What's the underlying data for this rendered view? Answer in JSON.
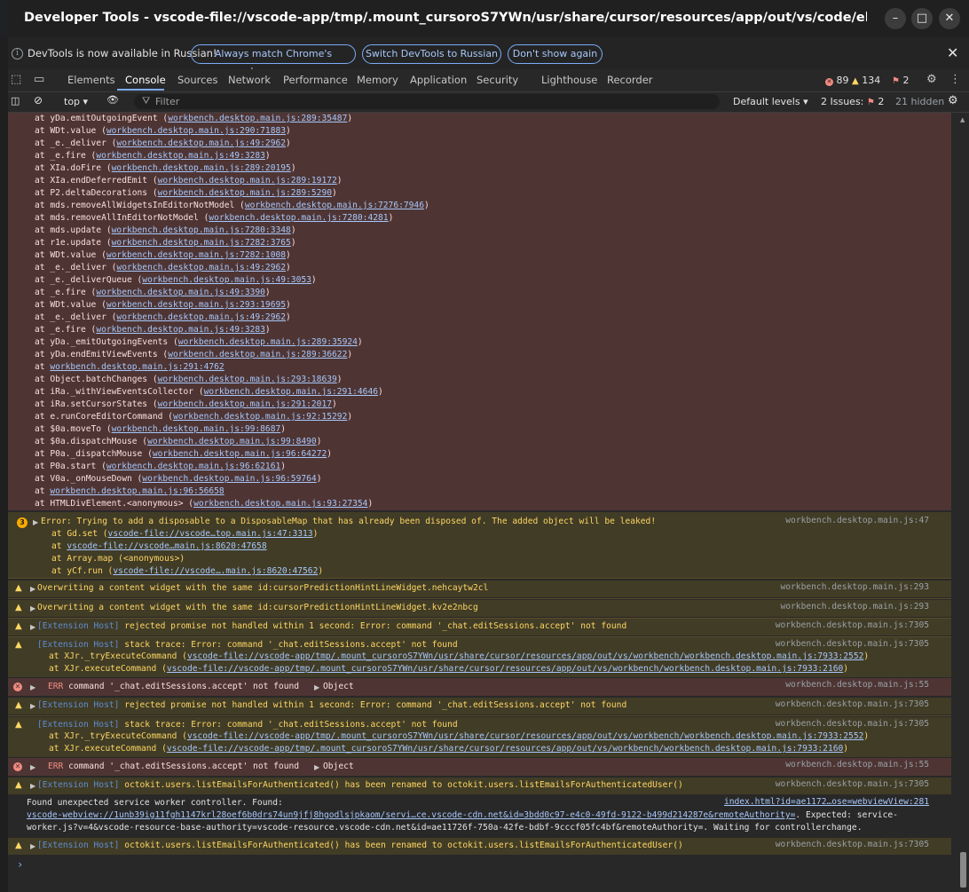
{
  "window": {
    "title": "Developer Tools - vscode-file://vscode-app/tmp/.mount_cursoroS7YWn/usr/share/cursor/resources/app/out/vs/code/electron-sandbo...",
    "min_glyph": "–",
    "max_glyph": "□",
    "close_glyph": "✕"
  },
  "infobar": {
    "message": "DevTools is now available in Russian!",
    "btn_match": "Always match Chrome's language",
    "btn_switch": "Switch DevTools to Russian",
    "btn_dont": "Don't show again",
    "close": "✕"
  },
  "tabs": [
    "Elements",
    "Console",
    "Sources",
    "Network",
    "Performance",
    "Memory",
    "Application",
    "Security",
    "Lighthouse",
    "Recorder"
  ],
  "counts": {
    "errors": "89",
    "warnings": "134",
    "issues": "2"
  },
  "toolbar": {
    "context": "top",
    "filter_placeholder": "Filter",
    "levels": "Default levels",
    "issues_label": "2 Issues:",
    "issues_count": "2",
    "hidden": "21 hidden"
  },
  "stack": [
    {
      "fn": "at yDa.emitOutgoingEvent (",
      "link": "workbench.desktop.main.js:289:35487",
      "end": ")"
    },
    {
      "fn": "at WDt.value (",
      "link": "workbench.desktop.main.js:290:71883",
      "end": ")"
    },
    {
      "fn": "at _e._deliver (",
      "link": "workbench.desktop.main.js:49:2962",
      "end": ")"
    },
    {
      "fn": "at _e.fire (",
      "link": "workbench.desktop.main.js:49:3283",
      "end": ")"
    },
    {
      "fn": "at XIa.doFire (",
      "link": "workbench.desktop.main.js:289:20195",
      "end": ")"
    },
    {
      "fn": "at XIa.endDeferredEmit (",
      "link": "workbench.desktop.main.js:289:19172",
      "end": ")"
    },
    {
      "fn": "at P2.deltaDecorations (",
      "link": "workbench.desktop.main.js:289:5290",
      "end": ")"
    },
    {
      "fn": "at mds.removeAllWidgetsInEditorNotModel (",
      "link": "workbench.desktop.main.js:7276:7946",
      "end": ")"
    },
    {
      "fn": "at mds.removeAllInEditorNotModel (",
      "link": "workbench.desktop.main.js:7280:4281",
      "end": ")"
    },
    {
      "fn": "at mds.update (",
      "link": "workbench.desktop.main.js:7280:3348",
      "end": ")"
    },
    {
      "fn": "at r1e.update (",
      "link": "workbench.desktop.main.js:7282:3765",
      "end": ")"
    },
    {
      "fn": "at WDt.value (",
      "link": "workbench.desktop.main.js:7282:1008",
      "end": ")"
    },
    {
      "fn": "at _e._deliver (",
      "link": "workbench.desktop.main.js:49:2962",
      "end": ")"
    },
    {
      "fn": "at _e._deliverQueue (",
      "link": "workbench.desktop.main.js:49:3053",
      "end": ")"
    },
    {
      "fn": "at _e.fire (",
      "link": "workbench.desktop.main.js:49:3390",
      "end": ")"
    },
    {
      "fn": "at WDt.value (",
      "link": "workbench.desktop.main.js:293:19695",
      "end": ")"
    },
    {
      "fn": "at _e._deliver (",
      "link": "workbench.desktop.main.js:49:2962",
      "end": ")"
    },
    {
      "fn": "at _e.fire (",
      "link": "workbench.desktop.main.js:49:3283",
      "end": ")"
    },
    {
      "fn": "at yDa._emitOutgoingEvents (",
      "link": "workbench.desktop.main.js:289:35924",
      "end": ")"
    },
    {
      "fn": "at yDa.endEmitViewEvents (",
      "link": "workbench.desktop.main.js:289:36622",
      "end": ")"
    },
    {
      "fn": "at ",
      "link": "workbench.desktop.main.js:291:4762",
      "end": ""
    },
    {
      "fn": "at Object.batchChanges (",
      "link": "workbench.desktop.main.js:293:18639",
      "end": ")"
    },
    {
      "fn": "at iRa._withViewEventsCollector (",
      "link": "workbench.desktop.main.js:291:4646",
      "end": ")"
    },
    {
      "fn": "at iRa.setCursorStates (",
      "link": "workbench.desktop.main.js:291:2017",
      "end": ")"
    },
    {
      "fn": "at e.runCoreEditorCommand (",
      "link": "workbench.desktop.main.js:92:15292",
      "end": ")"
    },
    {
      "fn": "at $0a.moveTo (",
      "link": "workbench.desktop.main.js:99:8687",
      "end": ")"
    },
    {
      "fn": "at $0a.dispatchMouse (",
      "link": "workbench.desktop.main.js:99:8490",
      "end": ")"
    },
    {
      "fn": "at P0a._dispatchMouse (",
      "link": "workbench.desktop.main.js:96:64272",
      "end": ")"
    },
    {
      "fn": "at P0a.start (",
      "link": "workbench.desktop.main.js:96:62161",
      "end": ")"
    },
    {
      "fn": "at V0a._onMouseDown (",
      "link": "workbench.desktop.main.js:96:59764",
      "end": ")"
    },
    {
      "fn": "at ",
      "link": "workbench.desktop.main.js:96:56658",
      "end": ""
    },
    {
      "fn": "at HTMLDivElement.<anonymous> (",
      "link": "workbench.desktop.main.js:93:27354",
      "end": ")"
    }
  ],
  "disposable": {
    "count": "3",
    "text": "Error: Trying to add a disposable to a DisposableMap that has already been disposed of. The added object will be leaked!",
    "src": "workbench.desktop.main.js:47",
    "lines": [
      {
        "fn": "at Gd.set (",
        "link": "vscode-file://vscode…top.main.js:47:3313",
        "end": ")"
      },
      {
        "fn": "at ",
        "link": "vscode-file://vscode…main.js:8620:47658",
        "end": ""
      },
      {
        "fn": "at Array.map (<anonymous>)",
        "link": "",
        "end": ""
      },
      {
        "fn": "at yCf.run (",
        "link": "vscode-file://vscode….main.js:8620:47562",
        "end": ")"
      }
    ]
  },
  "msgs": {
    "w1": {
      "text": "Overwriting a content widget with the same id:cursorPredictionHintLineWidget.nehcaytw2cl",
      "src": "workbench.desktop.main.js:293"
    },
    "w2": {
      "text": "Overwriting a content widget with the same id:cursorPredictionHintLineWidget.kv2e2nbcg",
      "src": "workbench.desktop.main.js:293"
    },
    "ext_tag": "[Extension Host]",
    "w3": {
      "text": " rejected promise not handled within 1 second: Error: command '_chat.editSessions.accept' not found",
      "src": "workbench.desktop.main.js:7305"
    },
    "w4": {
      "text": " stack trace: Error: command '_chat.editSessions.accept' not found",
      "src": "workbench.desktop.main.js:7305",
      "l1_fn": "at XJr._tryExecuteCommand (",
      "l1_link": "vscode-file://vscode-app/tmp/.mount_cursoroS7YWn/usr/share/cursor/resources/app/out/vs/workbench/workbench.desktop.main.js:7933:2552",
      "l2_fn": "at XJr.executeCommand (",
      "l2_link": "vscode-file://vscode-app/tmp/.mount_cursoroS7YWn/usr/share/cursor/resources/app/out/vs/workbench/workbench.desktop.main.js:7933:2160",
      "close": ")"
    },
    "e1": {
      "tag": "ERR",
      "text": " command '_chat.editSessions.accept' not found ",
      "obj": "Object",
      "src": "workbench.desktop.main.js:55"
    },
    "w7": {
      "text": " octokit.users.listEmailsForAuthenticated() has been renamed to octokit.users.listEmailsForAuthenticatedUser()",
      "src": "workbench.desktop.main.js:7305"
    },
    "info": {
      "l1": "Found unexpected service worker controller. Found:",
      "src_link": "index.html?id=ae1172…ose=webviewView:281",
      "l2_link": "vscode-webview://1unb39ig11fgh1147krl28oef6b0drs74un9jfj8hgodlsjpkaom/servi…ce.vscode-cdn.net&id=3bdd0c97-e4c0-49fd-9122-b499d214287e&remoteAuthority=",
      "l2_rest": ". Expected: service-",
      "l3": "worker.js?v=4&vscode-resource-base-authority=vscode-resource.vscode-cdn.net&id=ae11726f-750a-42fe-bdbf-9cccf05fc4bf&remoteAuthority=. Waiting for controllerchange."
    }
  },
  "prompt": "›"
}
